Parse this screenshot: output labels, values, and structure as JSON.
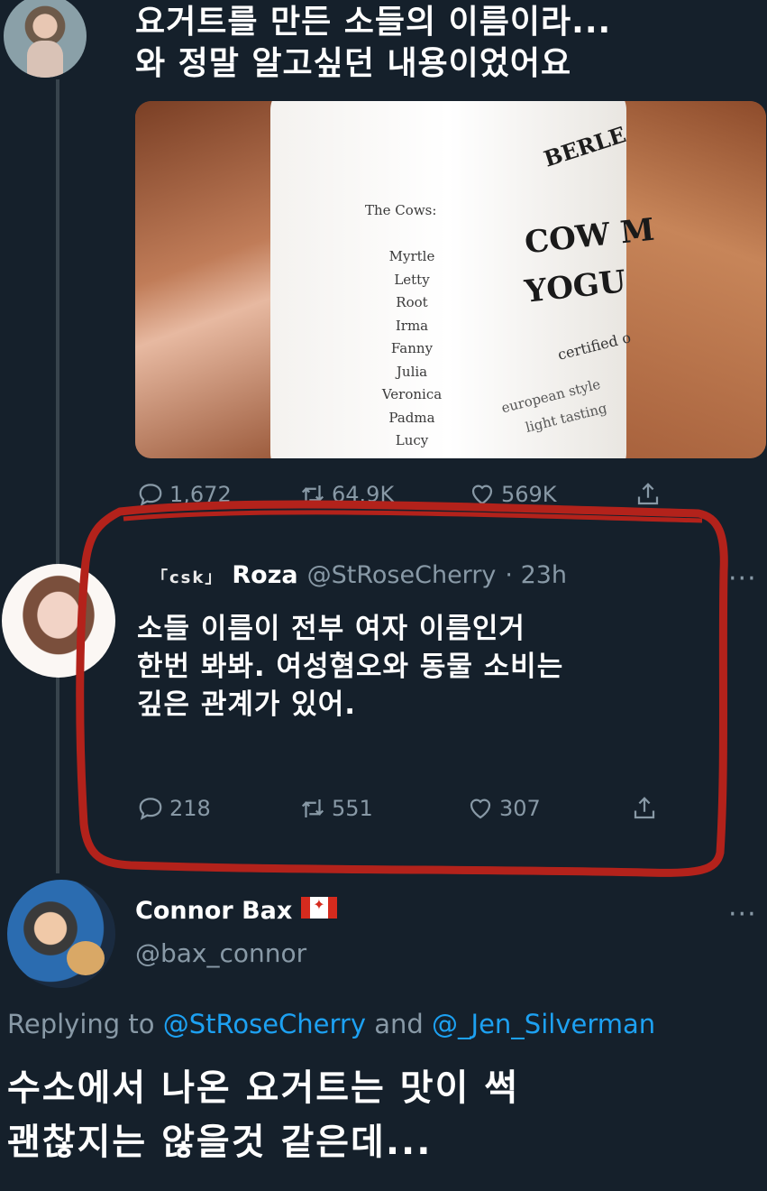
{
  "tweet1": {
    "text_line1": "요거트를 만든 소들의 이름이라...",
    "text_line2": "와 정말 알고싶던 내용이었어요",
    "photo": {
      "heading": "The Cows:",
      "cows": [
        "Myrtle",
        "Letty",
        "Root",
        "Irma",
        "Fanny",
        "Julia",
        "Veronica",
        "Padma",
        "Lucy"
      ],
      "brand": "BERLE",
      "product_line1": "COW M",
      "product_line2": "YOGU",
      "certified": "certified o",
      "euro": "european style",
      "light": "light tasting"
    },
    "actions": {
      "replies": "1,672",
      "retweets": "64.9K",
      "likes": "569K"
    }
  },
  "tweet2": {
    "prefix": "「csk」",
    "display_name": "Roza",
    "handle": "@StRoseCherry",
    "time": "· 23h",
    "more": "···",
    "text_line1": "소들 이름이 전부 여자 이름인거",
    "text_line2": "한번 봐봐. 여성혐오와 동물 소비는",
    "text_line3": "깊은 관계가 있어.",
    "actions": {
      "replies": "218",
      "retweets": "551",
      "likes": "307"
    }
  },
  "tweet3": {
    "display_name": "Connor Bax",
    "handle": "@bax_connor",
    "more": "···",
    "replying_prefix": "Replying to ",
    "mention1": "@StRoseCherry",
    "and": " and ",
    "mention2": "@_Jen_Silverman",
    "text_line1": "수소에서 나온 요거트는 맛이 썩",
    "text_line2": "괜찮지는 않을것 같은데..."
  },
  "colors": {
    "background": "#15202b",
    "secondary_text": "#8899a6",
    "link": "#1da1f2",
    "highlight_circle": "#b3221b"
  },
  "icons": [
    "reply-icon",
    "retweet-icon",
    "like-icon",
    "share-icon",
    "more-icon",
    "canada-flag-icon"
  ]
}
